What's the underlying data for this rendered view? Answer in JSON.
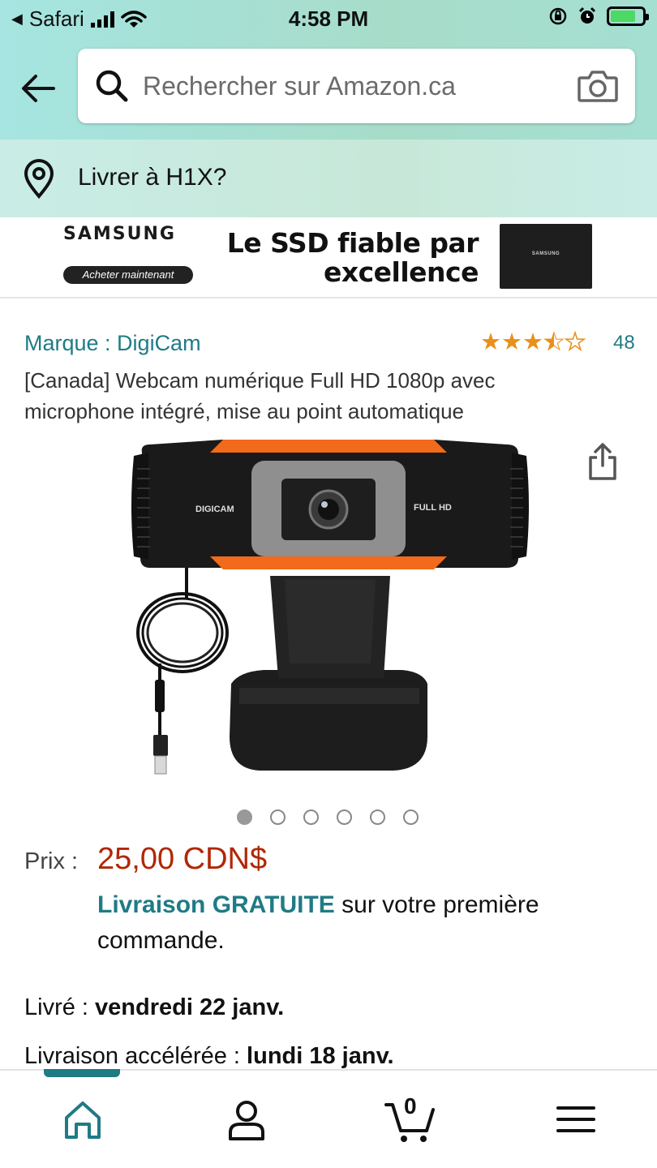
{
  "status_bar": {
    "back_app": "Safari",
    "time": "4:58 PM"
  },
  "header": {
    "search_placeholder": "Rechercher sur Amazon.ca",
    "deliver_to": "Livrer à H1X?"
  },
  "banner": {
    "brand": "SAMSUNG",
    "cta": "Acheter maintenant",
    "slogan_line1": "Le SSD fiable par",
    "slogan_line2": "excellence",
    "product_label": "SAMSUNG"
  },
  "product": {
    "brand": "Marque : DigiCam",
    "rating": 3.5,
    "rating_count": "48",
    "title": "[Canada] Webcam numérique Full HD 1080p avec microphone intégré, mise au point automatique",
    "image_labels": {
      "left": "DIGICAM",
      "right": "FULL HD"
    },
    "image_count": 6,
    "active_image": 1,
    "price_label": "Prix :",
    "price": "25,00 CDN$",
    "shipping_free": "Livraison GRATUITE",
    "shipping_rest": "sur votre première commande.",
    "delivery_label": "Livré :",
    "delivery_date": "vendredi 22 janv.",
    "fast_label": "Livraison accélérée :",
    "fast_date": "lundi 18 janv."
  },
  "nav": {
    "cart_count": "0",
    "items": [
      "home-icon",
      "account-icon",
      "cart-icon",
      "menu-icon"
    ]
  },
  "colors": {
    "accent": "#1f7b85",
    "price": "#b12704",
    "star": "#e98f1b",
    "header_bg": "#a6e5e1",
    "webcam_accent": "#f26a1b"
  }
}
